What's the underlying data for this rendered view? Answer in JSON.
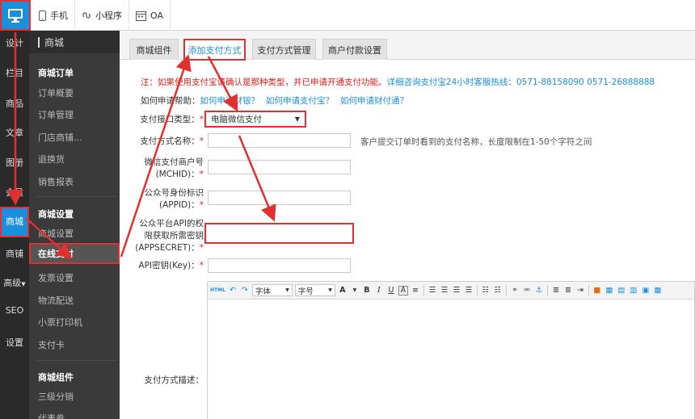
{
  "topbar": {
    "items": [
      {
        "label": "手机",
        "icon": "phone-icon"
      },
      {
        "label": "小程序",
        "icon": "mini-program-icon"
      },
      {
        "label": "OA",
        "icon": "calendar-icon"
      }
    ]
  },
  "leftbar": {
    "items": [
      "设计",
      "栏目",
      "商品",
      "文章",
      "图册",
      "会员",
      "商城",
      "商铺",
      "高级",
      "SEO",
      "设置"
    ]
  },
  "submenu": {
    "header": "商城",
    "groups": {
      "orders": "商城订单",
      "settings": "商城设置",
      "components": "商城组件"
    },
    "items": {
      "order_overview": "订单概要",
      "order_manage": "订单管理",
      "store_orders": "门店商铺...",
      "refund": "退换货",
      "sales_report": "销售报表",
      "mall_settings": "商城设置",
      "online_pay": "在线支付",
      "invoice": "发票设置",
      "logistics": "物流配送",
      "receipt_printer": "小票打印机",
      "pay_card": "支付卡",
      "three_level": "三级分销",
      "more": "代表券"
    }
  },
  "tabs": [
    "商城组件",
    "添加支付方式",
    "支付方式管理",
    "商户付款设置"
  ],
  "notice": {
    "text": "注：如果使用支付宝请确认是那种类型，并已申请开通支付功能。",
    "contact": "详细咨询支付宝24小时客服热线：0571-88158090 0571-26888888"
  },
  "howto": {
    "prefix": "如何申请帮助：",
    "links": [
      "如何申请财银？",
      "如何申请支付宝？",
      "如何申请财付通？"
    ]
  },
  "form": {
    "type_label": "支付接口类型：",
    "type_value": "电脑微信支付",
    "name_label": "支付方式名称：",
    "name_hint": "客户提交订单时看到的支付名称，长度限制在1-50个字符之间",
    "mchid_label_1": "微信支付商户号",
    "mchid_label_2": "(MCHID)：",
    "appid_label_1": "公众号身份标识",
    "appid_label_2": "(APPID)：",
    "secret_label_1": "公众平台API的权",
    "secret_label_2": "限获取所需密钥",
    "secret_label_3": "(APPSECRET)：",
    "key_label": "API密钥(Key)：",
    "desc_label": "支付方式描述："
  },
  "editor": {
    "font_family": "字体",
    "font_size": "字号",
    "html_btn": "HTML"
  },
  "colors": {
    "accent": "#1b8fdc",
    "highlight": "#e03030",
    "sidebar_dark": "#2a2a2a",
    "submenu_bg": "#3a3a3a"
  }
}
